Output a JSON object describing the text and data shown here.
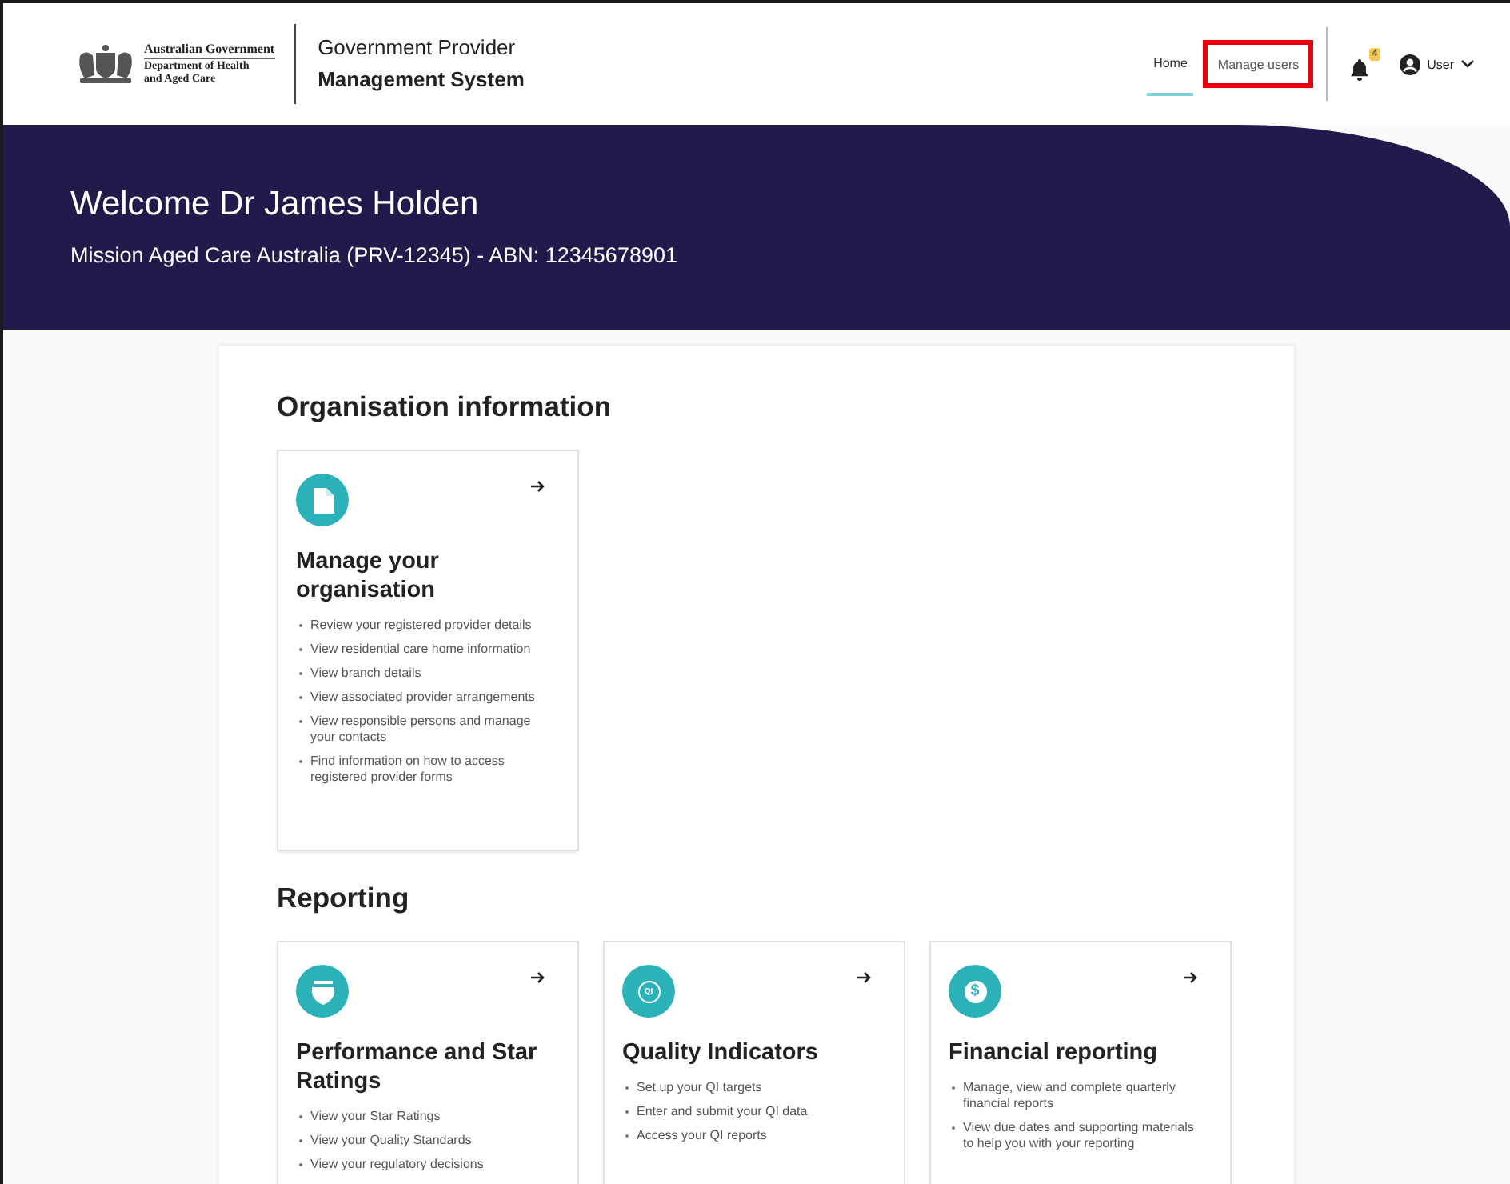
{
  "header": {
    "logo": {
      "line_1": "Australian Government",
      "line_2": "Department of Health",
      "line_3": "and Aged Care"
    },
    "system_title": {
      "line_1": "Government Provider",
      "line_2": "Management System"
    },
    "nav": [
      {
        "label": "Home",
        "selected": true,
        "highlighted": false
      },
      {
        "label": "Manage users",
        "selected": false,
        "highlighted": true
      }
    ],
    "notifications": {
      "count": "4"
    },
    "user_menu": {
      "label": "User"
    }
  },
  "banner": {
    "title": "Welcome Dr James Holden",
    "subtitle": "Mission Aged Care Australia (PRV-12345) - ABN: 12345678901"
  },
  "sections": [
    {
      "heading": "Organisation information",
      "cards": [
        {
          "kind": "document",
          "title": "Manage your organisation",
          "items": [
            "Review your registered provider details",
            "View residential care home information",
            "View branch details",
            "View associated provider arrangements",
            "View responsible persons and manage your contacts",
            "Find information on how to access registered provider forms"
          ]
        }
      ]
    },
    {
      "heading": "Reporting",
      "cards": [
        {
          "kind": "shield",
          "title": "Performance and Star Ratings",
          "items": [
            "View your Star Ratings",
            "View your Quality Standards",
            "View your regulatory decisions"
          ]
        },
        {
          "kind": "qi",
          "icon_label": "QI",
          "title": "Quality Indicators",
          "items": [
            "Set up your QI targets",
            "Enter and submit your QI data",
            "Access your QI reports"
          ]
        },
        {
          "kind": "dollar",
          "icon_label": "$",
          "title": "Financial reporting",
          "items": [
            "Manage, view and complete quarterly financial reports",
            "View due dates and supporting materials to help you with your reporting"
          ]
        }
      ]
    }
  ]
}
